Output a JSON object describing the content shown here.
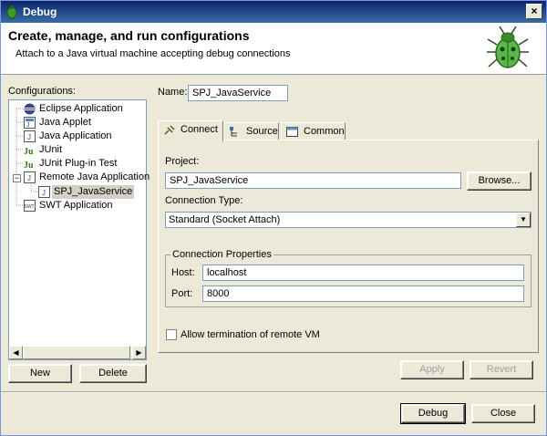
{
  "window": {
    "title": "Debug",
    "close_glyph": "×"
  },
  "banner": {
    "heading": "Create, manage, and run configurations",
    "subtext": "Attach to a Java virtual machine accepting debug connections",
    "icon": "bug-icon"
  },
  "configurations": {
    "label": "Configurations:",
    "items": [
      {
        "label": "Eclipse Application",
        "icon": "eclipse-icon"
      },
      {
        "label": "Java Applet",
        "icon": "applet-icon"
      },
      {
        "label": "Java Application",
        "icon": "java-app-icon"
      },
      {
        "label": "JUnit",
        "icon": "junit-icon"
      },
      {
        "label": "JUnit Plug-in Test",
        "icon": "junit-plugin-icon"
      },
      {
        "label": "Remote Java Application",
        "icon": "remote-java-icon"
      },
      {
        "label": "SPJ_JavaService",
        "icon": "java-config-icon",
        "selected": true
      },
      {
        "label": "SWT Application",
        "icon": "swt-icon"
      }
    ],
    "new_label": "New",
    "delete_label": "Delete"
  },
  "form": {
    "name_label": "Name:",
    "name_value": "SPJ_JavaService",
    "tabs": [
      {
        "label": "Connect",
        "active": true
      },
      {
        "label": "Source"
      },
      {
        "label": "Common"
      }
    ],
    "project_label": "Project:",
    "project_value": "SPJ_JavaService",
    "browse_label": "Browse...",
    "connection_type_label": "Connection Type:",
    "connection_type_value": "Standard (Socket Attach)",
    "connection_props_title": "Connection Properties",
    "host_label": "Host:",
    "host_value": "localhost",
    "port_label": "Port:",
    "port_value": "8000",
    "allow_termination_label": "Allow termination of remote VM",
    "allow_termination_checked": false
  },
  "actions": {
    "apply_label": "Apply",
    "revert_label": "Revert",
    "debug_label": "Debug",
    "close_label": "Close"
  }
}
